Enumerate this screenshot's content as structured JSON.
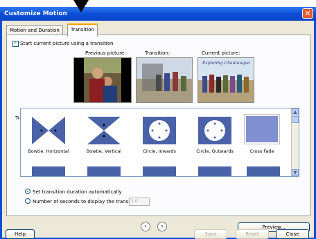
{
  "window": {
    "title": "Customize Motion",
    "close_glyph": "✕"
  },
  "tabs": [
    {
      "label": "Motion and Duration"
    },
    {
      "label": "Transition"
    }
  ],
  "options": {
    "start_transition_label": "Start current picture using a transition"
  },
  "previews": {
    "previous_label": "Previous picture:",
    "transition_label": "Transition:",
    "current_label": "Current picture:",
    "current_caption": "Exploring Chautauqua"
  },
  "transitions": {
    "label": "Transitions:",
    "items": [
      {
        "name": "Bowtie, Horizontal"
      },
      {
        "name": "Bowtie, Vertical"
      },
      {
        "name": "Circle, Inwards"
      },
      {
        "name": "Circle, Outwards"
      },
      {
        "name": "Cross Fade"
      }
    ]
  },
  "duration": {
    "auto_label": "Set transition duration automatically",
    "seconds_label": "Number of seconds to display the transition",
    "seconds_value": "1.0"
  },
  "nav": {
    "prev_glyph": "‹",
    "next_glyph": "›"
  },
  "buttons": {
    "preview": "Preview...",
    "help": "Help",
    "save": "Save",
    "reset": "Reset",
    "close": "Close"
  },
  "colors": {
    "title_bar": "#0b4fd8",
    "dialog_bg": "#ece9d8",
    "tile": "#4a62a8",
    "tab_highlight": "#f7a300"
  }
}
